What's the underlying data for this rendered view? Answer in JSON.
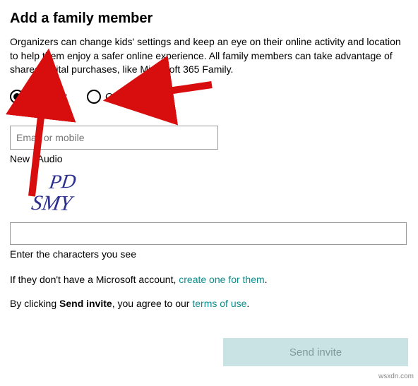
{
  "heading": "Add a family member",
  "description": "Organizers can change kids' settings and keep an eye on their online activity and location to help them enjoy a safer online experience. All family members can take advantage of shared digital purchases, like Microsoft 365 Family.",
  "role_options": {
    "member": {
      "label": "Member",
      "selected": true
    },
    "organizer": {
      "label": "Organizer",
      "selected": false
    }
  },
  "email_input": {
    "placeholder": "Email or mobile",
    "value": ""
  },
  "captcha": {
    "new_label": "New",
    "audio_label": "Audio",
    "image_text": "PD SMY",
    "hint": "Enter the characters you see",
    "input_value": ""
  },
  "no_account_line": {
    "prefix": "If they don't have a Microsoft account, ",
    "link": "create one for them",
    "suffix": "."
  },
  "terms_line": {
    "prefix": "By clicking ",
    "bold": "Send invite",
    "mid": ", you agree to our ",
    "link": "terms of use",
    "suffix": "."
  },
  "send_button_label": "Send invite",
  "watermark": "wsxdn.com",
  "colors": {
    "link": "#0f8b8b",
    "button_bg": "#c9e3e4",
    "button_fg": "#7e9b9c",
    "arrow": "#d80e0e",
    "captcha_ink": "#2c2f8f"
  }
}
